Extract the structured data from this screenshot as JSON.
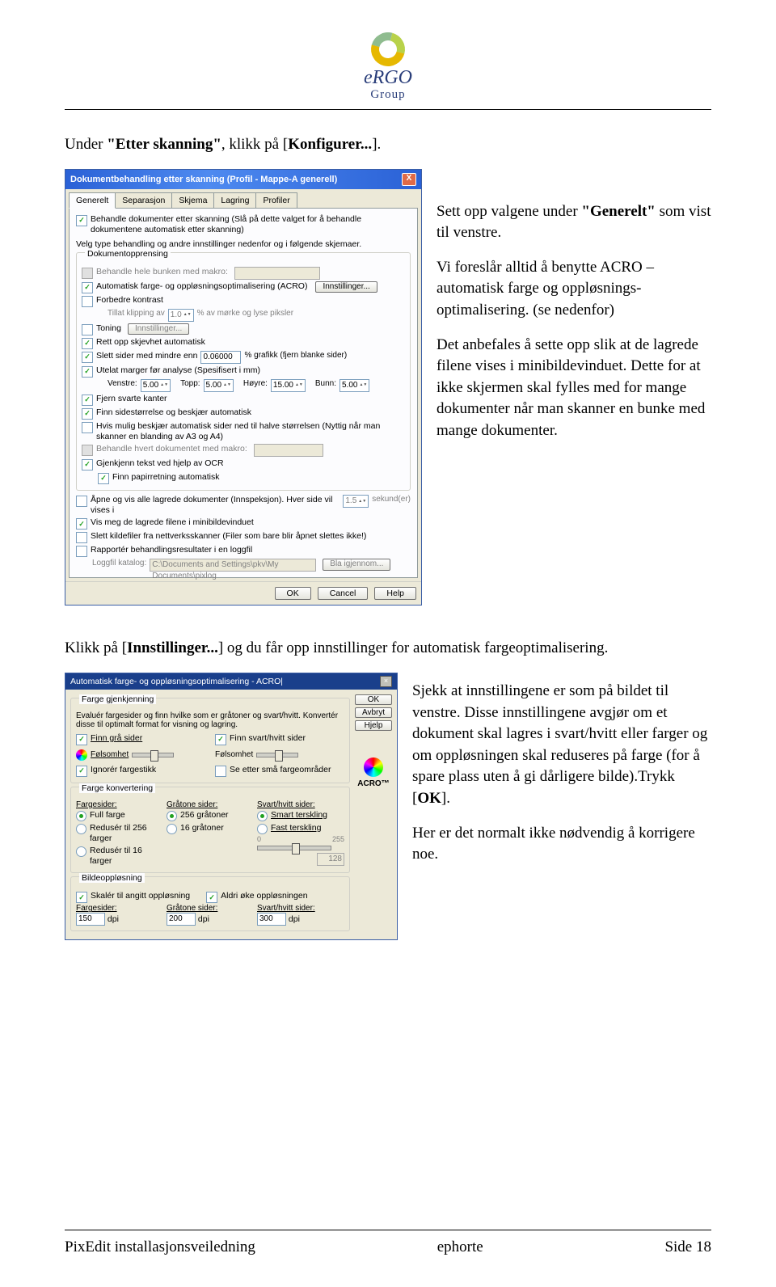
{
  "logo": {
    "name": "eRGO",
    "sub": "Group"
  },
  "intro": {
    "prefix": "Under ",
    "q1": "\"Etter skanning\"",
    "mid": ", klikk på [",
    "bold": "Konfigurer...",
    "suffix": "]."
  },
  "dialog1": {
    "title": "Dokumentbehandling etter skanning (Profil - Mappe-A generell)",
    "tabs": [
      "Generelt",
      "Separasjon",
      "Skjema",
      "Lagring",
      "Profiler"
    ],
    "top_check": "Behandle dokumenter etter skanning (Slå på dette valget for å behandle dokumentene automatisk etter skanning)",
    "top_desc": "Velg type behandling og andre innstillinger nedenfor og i følgende skjemaer.",
    "fs_opp": "Dokumentopprensing",
    "behandle_makro": "Behandle hele bunken med makro:",
    "acro": "Automatisk farge- og oppløsningsoptimalisering (ACRO)",
    "innstillinger_btn": "Innstillinger...",
    "forbedre": "Forbedre kontrast",
    "tillat": "Tillat klipping av",
    "tillat2": "% av mørke og lyse piksler",
    "tillat_val": "1.0",
    "toning": "Toning",
    "rett": "Rett opp skjevhet automatisk",
    "slett_mindre": "Slett sider med mindre enn",
    "slett_val": "0.06000",
    "slett_suffix": "% grafikk (fjern blanke sider)",
    "utelat": "Utelat marger før analyse (Spesifisert i mm)",
    "venstre": "Venstre:",
    "venstre_v": "5.00",
    "topp": "Topp:",
    "topp_v": "5.00",
    "hoyre": "Høyre:",
    "hoyre_v": "15.00",
    "bunn": "Bunn:",
    "bunn_v": "5.00",
    "fjern": "Fjern svarte kanter",
    "finn_side": "Finn sidestørrelse og beskjær automatisk",
    "hvis_mulig": "Hvis mulig beskjær automatisk sider ned til halve størrelsen (Nyttig når man skanner en blanding av A3 og A4)",
    "behandle_hvert": "Behandle hvert dokumentet med makro:",
    "gjenkjenn": "Gjenkjenn tekst ved hjelp av OCR",
    "finn_papir": "Finn papirretning automatisk",
    "apne": "Åpne og vis alle lagrede dokumenter (Innspeksjon). Hver side vil vises i",
    "apne_val": "1.5",
    "apne_suf": "sekund(er)",
    "vis_meg": "Vis meg de lagrede filene i minibildevinduet",
    "slett_kilde": "Slett kildefiler fra nettverksskanner (Filer som bare blir åpnet slettes ikke!)",
    "rapporter": "Rapportér behandlingsresultater i en loggfil",
    "loggfil": "Loggfil katalog:",
    "logpath": "C:\\Documents and Settings\\pkv\\My Documents\\pixlog",
    "bla": "Bla igjennom...",
    "ok": "OK",
    "cancel": "Cancel",
    "help": "Help"
  },
  "para1": {
    "a": "Sett opp valgene under ",
    "b": "\"Generelt\"",
    "c": " som vist til venstre."
  },
  "para2": "Vi foreslår alltid å benytte ACRO – automatisk farge og oppløsnings-optimalisering. (se nedenfor)",
  "para3": "Det anbefales å sette opp slik at de lagrede filene vises i minibildevinduet. Dette for at ikke skjermen skal fylles med for mange dokumenter når man skanner en bunke med mange dokumenter.",
  "mid": {
    "a": "Klikk på [",
    "b": "Innstillinger...",
    "c": "] og du får opp innstillinger for automatisk fargeoptimalisering."
  },
  "dialog2": {
    "title": "Automatisk farge- og oppløsningsoptimalisering - ACRO|",
    "ok": "OK",
    "avbryt": "Avbryt",
    "hjelp": "Hjelp",
    "fg_title": "Farge gjenkjenning",
    "fg_desc": "Evaluér fargesider og finn hvilke som er gråtoner og svart/hvitt. Konvertér disse til optimalt format for visning og lagring.",
    "finn_gra": "Finn grå sider",
    "finn_sv": "Finn svart/hvitt sider",
    "folsomhet": "Følsomhet",
    "ignorer": "Ignorér fargestikk",
    "se_etter": "Se etter små fargeområder",
    "fk_title": "Farge konvertering",
    "fargesider": "Fargesider:",
    "gratone": "Gråtone sider:",
    "svarthvitt": "Svart/hvitt sider:",
    "full": "Full farge",
    "r256": "Redusér til 256 farger",
    "r16": "Redusér til 16 farger",
    "g256": "256 gråtoner",
    "g16": "16 gråtoner",
    "smart": "Smart terskling",
    "fast": "Fast terskling",
    "v255": "255",
    "v128": "128",
    "v0": "0",
    "bo_title": "Bildeoppløsning",
    "skaler": "Skalér til angitt oppløsning",
    "aldri": "Aldri øke oppløsningen",
    "dpi": "dpi",
    "v150": "150",
    "v200": "200",
    "v300": "300",
    "acro": "ACRO™"
  },
  "rpara1": {
    "a": "Sjekk at innstillingene er som på bildet til venstre. Disse innstillingene avgjør om et dokument skal lagres i svart/hvitt eller farger og om oppløsningen skal reduseres på farge (for å spare plass uten å gi dårligere bilde).Trykk [",
    "b": "OK",
    "c": "]."
  },
  "rpara2": "Her er det normalt ikke nødvendig å korrigere noe.",
  "footer": {
    "left": "PixEdit installasjonsveiledning",
    "center": "ephorte",
    "right": "Side 18"
  }
}
